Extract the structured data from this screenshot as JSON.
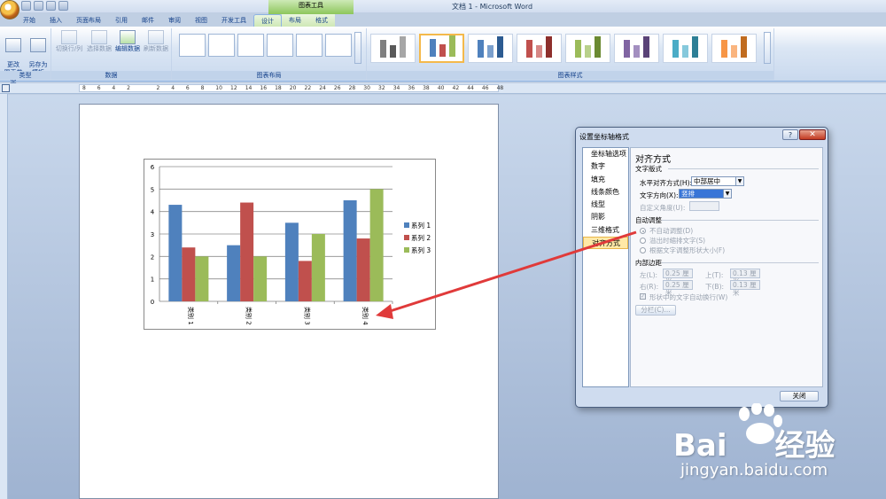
{
  "window": {
    "title": "文档 1 - Microsoft Word",
    "contextual_tab_group": "图表工具"
  },
  "tabs": [
    {
      "label": "开始"
    },
    {
      "label": "插入"
    },
    {
      "label": "页面布局"
    },
    {
      "label": "引用"
    },
    {
      "label": "邮件"
    },
    {
      "label": "审阅"
    },
    {
      "label": "视图"
    },
    {
      "label": "开发工具"
    },
    {
      "label": "设计"
    },
    {
      "label": "布局"
    },
    {
      "label": "格式"
    }
  ],
  "ribbon": {
    "type_group": {
      "label": "类型",
      "change_type": "更改\n图表类型",
      "save_template": "另存为\n模板"
    },
    "data_group": {
      "label": "数据",
      "switch_row_col": "切换行/列",
      "select_data": "选择数据",
      "edit_data": "编辑数据",
      "refresh_data": "刷新数据"
    },
    "layout_group": {
      "label": "图表布局"
    },
    "style_group": {
      "label": "图表样式"
    }
  },
  "ruler_numbers": [
    "8",
    "6",
    "4",
    "2",
    "",
    "2",
    "4",
    "6",
    "8",
    "10",
    "12",
    "14",
    "16",
    "18",
    "20",
    "22",
    "24",
    "26",
    "28",
    "30",
    "32",
    "34",
    "36",
    "38",
    "40",
    "42",
    "44",
    "46",
    "48"
  ],
  "chart_data": {
    "type": "bar",
    "categories": [
      "类别 1",
      "类别 2",
      "类别 3",
      "类别 4"
    ],
    "series": [
      {
        "name": "系列 1",
        "values": [
          4.3,
          2.5,
          3.5,
          4.5
        ],
        "color": "#4f81bd"
      },
      {
        "name": "系列 2",
        "values": [
          2.4,
          4.4,
          1.8,
          2.8
        ],
        "color": "#c0504d"
      },
      {
        "name": "系列 3",
        "values": [
          2.0,
          2.0,
          3.0,
          5.0
        ],
        "color": "#9bbb59"
      }
    ],
    "ylim": [
      0,
      6
    ],
    "yticks": [
      "0",
      "1",
      "2",
      "3",
      "4",
      "5",
      "6"
    ],
    "grid": true,
    "legend": "right",
    "category_label_direction": "rotated-vertical"
  },
  "dialog": {
    "title": "设置坐标轴格式",
    "help": "?",
    "close_glyph": "✕",
    "nav": [
      "坐标轴选项",
      "数字",
      "填充",
      "线条颜色",
      "线型",
      "阴影",
      "三维格式",
      "对齐方式"
    ],
    "active_nav": "对齐方式",
    "heading": "对齐方式",
    "text_layout": "文字版式",
    "h_align_label": "水平对齐方式(H):",
    "h_align_value": "中部居中",
    "text_dir_label": "文字方向(X):",
    "text_dir_value": "竖排",
    "custom_angle_label": "自定义角度(U):",
    "autofit_heading": "自动调整",
    "autofit_options": [
      "不自动调整(D)",
      "溢出时缩排文字(S)",
      "根据文字调整形状大小(F)"
    ],
    "inner_margin_heading": "内部边距",
    "margin_left_label": "左(L):",
    "margin_left_value": "0.25 厘米",
    "margin_top_label": "上(T):",
    "margin_top_value": "0.13 厘米",
    "margin_right_label": "右(R):",
    "margin_right_value": "0.25 厘米",
    "margin_bottom_label": "下(B):",
    "margin_bottom_value": "0.13 厘米",
    "wrap_text_label": "形状中的文字自动换行(W)",
    "columns_button": "分栏(C)...",
    "close_button": "关闭"
  },
  "watermark": {
    "brand": "Bai",
    "brand_cn": "经验",
    "url": "jingyan.baidu.com"
  },
  "colors": {
    "arrow": "#e03a3a",
    "selected_style_border": "#f4b94b"
  }
}
